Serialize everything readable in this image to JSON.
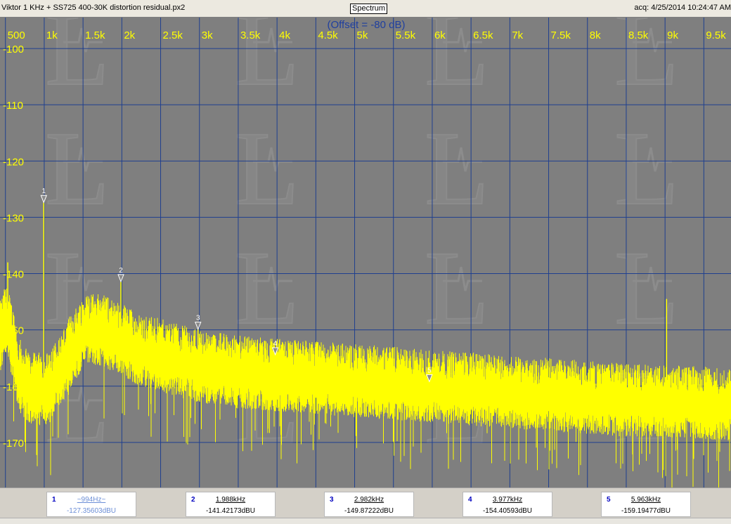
{
  "window": {
    "title": "Viktor 1 KHz + SS725 400-30K distortion residual.px2",
    "mode": "Spectrum",
    "acquired": "acq: 4/25/2014 10:24:47 AM"
  },
  "chart_data": {
    "type": "line",
    "offset_label": "(Offset = -80 dB)",
    "x_tick_labels": [
      "500",
      "1k",
      "1.5k",
      "2k",
      "2.5k",
      "3k",
      "3.5k",
      "4k",
      "4.5k",
      "5k",
      "5.5k",
      "6k",
      "6.5k",
      "7k",
      "7.5k",
      "8k",
      "8.5k",
      "9k",
      "9.5k"
    ],
    "x_tick_values": [
      500,
      1000,
      1500,
      2000,
      2500,
      3000,
      3500,
      4000,
      4500,
      5000,
      5500,
      6000,
      6500,
      7000,
      7500,
      8000,
      8500,
      9000,
      9500
    ],
    "y_tick_labels": [
      "-100",
      "-110",
      "-120",
      "-130",
      "-140",
      "-150",
      "-160",
      "-170"
    ],
    "y_tick_values": [
      -100,
      -110,
      -120,
      -130,
      -140,
      -150,
      -160,
      -170
    ],
    "xlim": [
      430,
      9850
    ],
    "ylim": [
      -178,
      -94.5
    ],
    "series": [
      {
        "values_note": "noise floor (dBu) vs frequency (Hz)",
        "x": [
          430,
          500,
          540,
          600,
          650,
          700,
          800,
          900,
          994,
          1050,
          1100,
          1200,
          1300,
          1400,
          1500,
          1600,
          1700,
          1800,
          1900,
          2000,
          2200,
          2500,
          3000,
          3500,
          4000,
          4500,
          5000,
          5500,
          6000,
          6500,
          7000,
          7500,
          8000,
          8500,
          9000,
          9500,
          9850
        ],
        "values": [
          -151,
          -148,
          -149,
          -152,
          -156,
          -158,
          -160,
          -160,
          -160,
          -160,
          -159,
          -157,
          -154,
          -152,
          -150,
          -149,
          -149.5,
          -150,
          -150.5,
          -151,
          -153,
          -154,
          -156,
          -157,
          -157.5,
          -158,
          -158.5,
          -159,
          -159.5,
          -160,
          -160.5,
          -161,
          -161.5,
          -162,
          -162.2,
          -162.5,
          -162.7
        ]
      }
    ],
    "spurs": [
      {
        "x": 530,
        "y": -138
      },
      {
        "x": 9020,
        "y": -144.5
      }
    ],
    "markers": [
      {
        "id": "1",
        "x": 994,
        "y": -127.35603,
        "freq_label": "~994Hz~",
        "level_label": "-127.35603dBU"
      },
      {
        "id": "2",
        "x": 1988,
        "y": -141.42173,
        "freq_label": "1.988kHz",
        "level_label": "-141.42173dBU"
      },
      {
        "id": "3",
        "x": 2982,
        "y": -149.87222,
        "freq_label": "2.982kHz",
        "level_label": "-149.87222dBU"
      },
      {
        "id": "4",
        "x": 3977,
        "y": -154.40593,
        "freq_label": "3.977kHz",
        "level_label": "-154.40593dBU"
      },
      {
        "id": "5",
        "x": 5963,
        "y": -159.19477,
        "freq_label": "5.963kHz",
        "level_label": "-159.19477dBU"
      }
    ],
    "grid": true,
    "colors": {
      "background": "#7f7f7f",
      "grid": "#1f3f8f",
      "trace": "#ffff00",
      "axis_text": "#ffff00",
      "offset_text": "#1f3f9f",
      "marker": "#ffffff"
    }
  }
}
